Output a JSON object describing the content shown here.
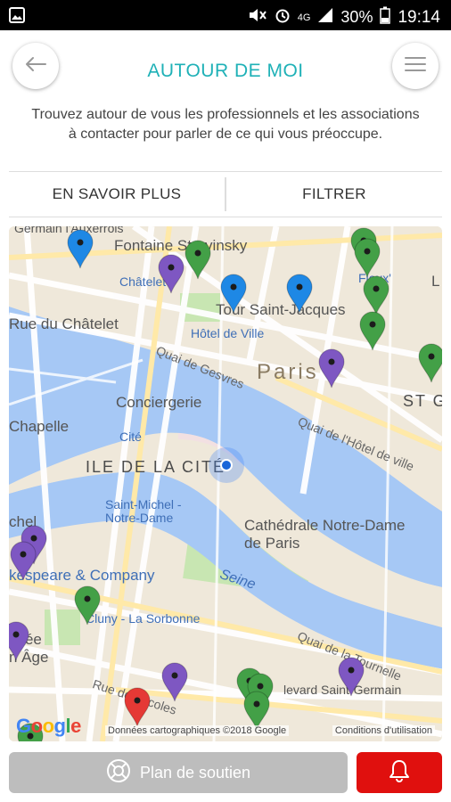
{
  "status_bar": {
    "battery_percent": "30%",
    "network": "4G",
    "time": "19:14",
    "icons": [
      "photo-icon",
      "mute-icon",
      "alarm-icon",
      "signal-icon",
      "battery-icon"
    ]
  },
  "header": {
    "title": "AUTOUR DE MOI",
    "back_icon": "arrow-left-icon",
    "menu_icon": "hamburger-menu-icon"
  },
  "subtitle": "Trouvez autour de vous les professionnels et les associations à contacter pour parler de ce qui vous préoccupe.",
  "tabs": [
    {
      "label": "EN SAVOIR PLUS"
    },
    {
      "label": "FILTRER"
    }
  ],
  "map": {
    "labels": {
      "germain_auxerrois": "Germain l'Auxerrois",
      "fontaine": "Fontaine Stravinsky",
      "chatelet": "Châtelet",
      "rue_chatelet": "Rue du Châtelet",
      "tour": "Tour Saint-Jacques",
      "hotel_ville": "Hôtel de Ville",
      "quai_gesvres": "Quai de Gesvres",
      "paris": "Paris",
      "st": "ST G",
      "conciergerie": "Conciergerie",
      "chapelle": "Chapelle",
      "cite": "Cité",
      "ile": "ILE DE LA CITÉ",
      "quai_hotel": "Quai de l'Hôtel de ville",
      "st_michel": "Saint-Michel - Notre-Dame",
      "cathedrale": "Cathédrale Notre-Dame de Paris",
      "shakespeare": "kespeare & Company",
      "chel": "chel",
      "seine": "Seine",
      "sorbonne": "Cluny - La Sorbonne",
      "usee": "usée",
      "age": "n Âge",
      "quai_tournelle": "Quai de la Tournelle",
      "bd_st_germain": "levard Saint-Germain",
      "rue_ecoles": "Rue des Écoles",
      "fleux": "Fleux'",
      "l": "L"
    },
    "google_logo": "Google",
    "credit": "Données cartographiques ©2018 Google",
    "terms": "Conditions d'utilisation",
    "pin_colors": {
      "blue": "#1e88e5",
      "purple": "#7e57c2",
      "green": "#43a047",
      "red": "#e53935"
    }
  },
  "buttons": {
    "support_label": "Plan de soutien",
    "support_icon": "lifebuoy-icon",
    "alert_icon": "bell-icon"
  },
  "colors": {
    "accent": "#1fb1b7",
    "alert": "#e0100e",
    "support_button": "#bdbdbd"
  }
}
